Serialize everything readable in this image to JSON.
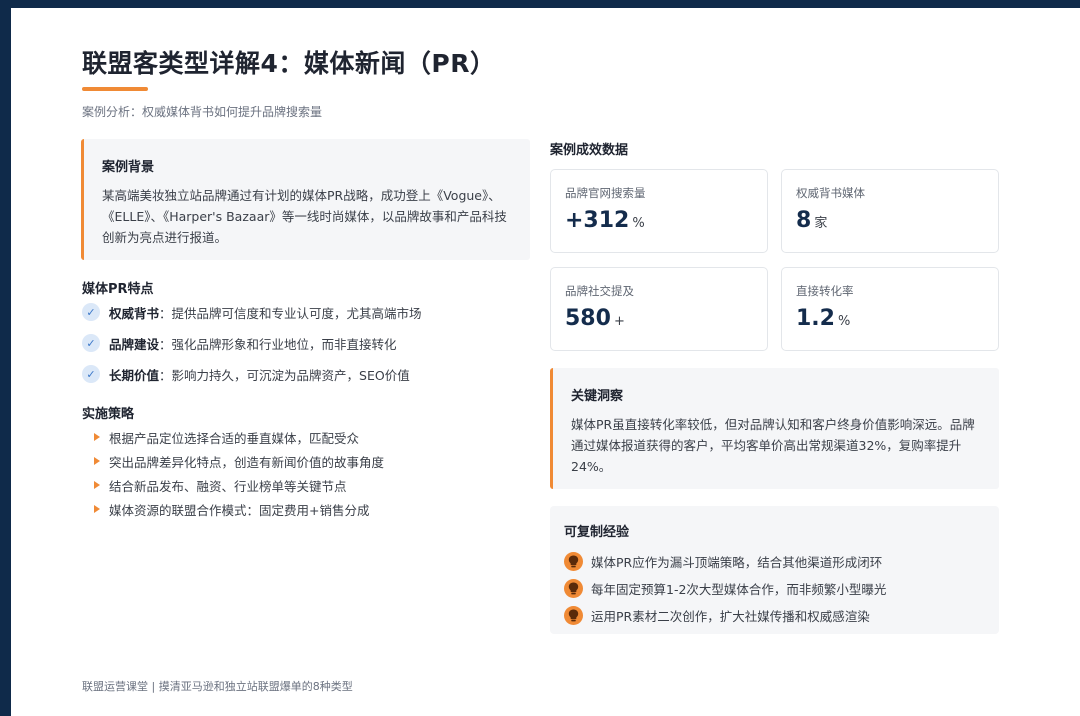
{
  "header": {
    "title": "联盟客类型详解4：媒体新闻（PR）",
    "subtitle": "案例分析：权威媒体背书如何提升品牌搜索量"
  },
  "background_card": {
    "heading": "案例背景",
    "body": "某高端美妆独立站品牌通过有计划的媒体PR战略，成功登上《Vogue》、《ELLE》、《Harper's Bazaar》等一线时尚媒体，以品牌故事和产品科技创新为亮点进行报道。"
  },
  "features": {
    "heading": "媒体PR特点",
    "items": [
      {
        "name": "权威背书",
        "desc": "：提供品牌可信度和专业认可度，尤其高端市场"
      },
      {
        "name": "品牌建设",
        "desc": "：强化品牌形象和行业地位，而非直接转化"
      },
      {
        "name": "长期价值",
        "desc": "：影响力持久，可沉淀为品牌资产，SEO价值"
      }
    ]
  },
  "strategy": {
    "heading": "实施策略",
    "items": [
      "根据产品定位选择合适的垂直媒体，匹配受众",
      "突出品牌差异化特点，创造有新闻价值的故事角度",
      "结合新品发布、融资、行业榜单等关键节点",
      "媒体资源的联盟合作模式：固定费用+销售分成"
    ]
  },
  "results": {
    "heading": "案例成效数据",
    "stats": [
      {
        "label": "品牌官网搜索量",
        "value": "+312",
        "unit": "%"
      },
      {
        "label": "权威背书媒体",
        "value": "8",
        "unit": "家"
      },
      {
        "label": "品牌社交提及",
        "value": "580",
        "unit": "+"
      },
      {
        "label": "直接转化率",
        "value": "1.2",
        "unit": "%"
      }
    ]
  },
  "insight": {
    "heading": "关键洞察",
    "body": "媒体PR虽直接转化率较低，但对品牌认知和客户终身价值影响深远。品牌通过媒体报道获得的客户，平均客单价高出常规渠道32%，复购率提升24%。"
  },
  "experience": {
    "heading": "可复制经验",
    "items": [
      "媒体PR应作为漏斗顶端策略，结合其他渠道形成闭环",
      "每年固定预算1-2次大型媒体合作，而非频繁小型曝光",
      "运用PR素材二次创作，扩大社媒传播和权威感渲染"
    ]
  },
  "footer": {
    "text": "联盟运营课堂 | 摸清亚马逊和独立站联盟爆单的8种类型"
  },
  "colors": {
    "accent": "#f08a35",
    "navy": "#0f2a4a",
    "stat_value": "#142c4c",
    "check": "#3c78c8"
  },
  "icons": {
    "feature": "check-circle-icon",
    "strategy": "triangle-bullet-icon",
    "experience": "lightbulb-icon"
  }
}
